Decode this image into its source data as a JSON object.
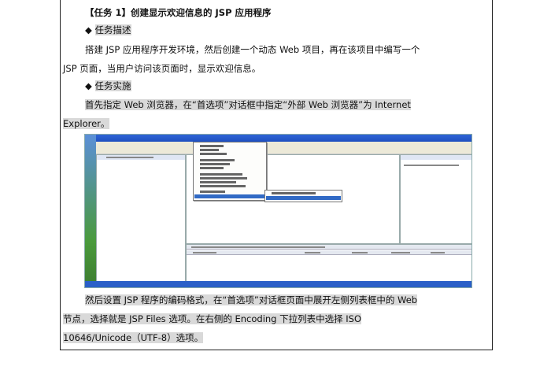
{
  "heading": "【任务 1】创建显示欢迎信息的 JSP 应用程序",
  "bullet_glyph": "◆",
  "sections": {
    "desc_title": "任务描述",
    "impl_title": "任务实施"
  },
  "paragraphs": {
    "desc_line1": "搭建 JSP 应用程序开发环境，然后创建一个动态 Web 项目，再在该项目中编写一个",
    "desc_line2": "JSP 页面，当用户访问该页面时，显示欢迎信息。",
    "impl_line1": "首先指定 Web 浏览器，在“首选项”对话框中指定“外部 Web 浏览器”为 Internet",
    "impl_line2": "Explorer。",
    "after_line1": "然后设置 JSP 程序的编码格式，在“首选项”对话框页面中展开左侧列表框中的 Web",
    "after_line2": "节点，选择就是 JSP Files 选项。在右侧的 Encoding 下拉列表中选择 ISO",
    "after_line3": "10646/Unicode（UTF-8）选项。"
  },
  "colors": {
    "highlight": "#d9d9d9",
    "menu_selection": "#316ac5",
    "titlebar": "#1e4fbf"
  }
}
